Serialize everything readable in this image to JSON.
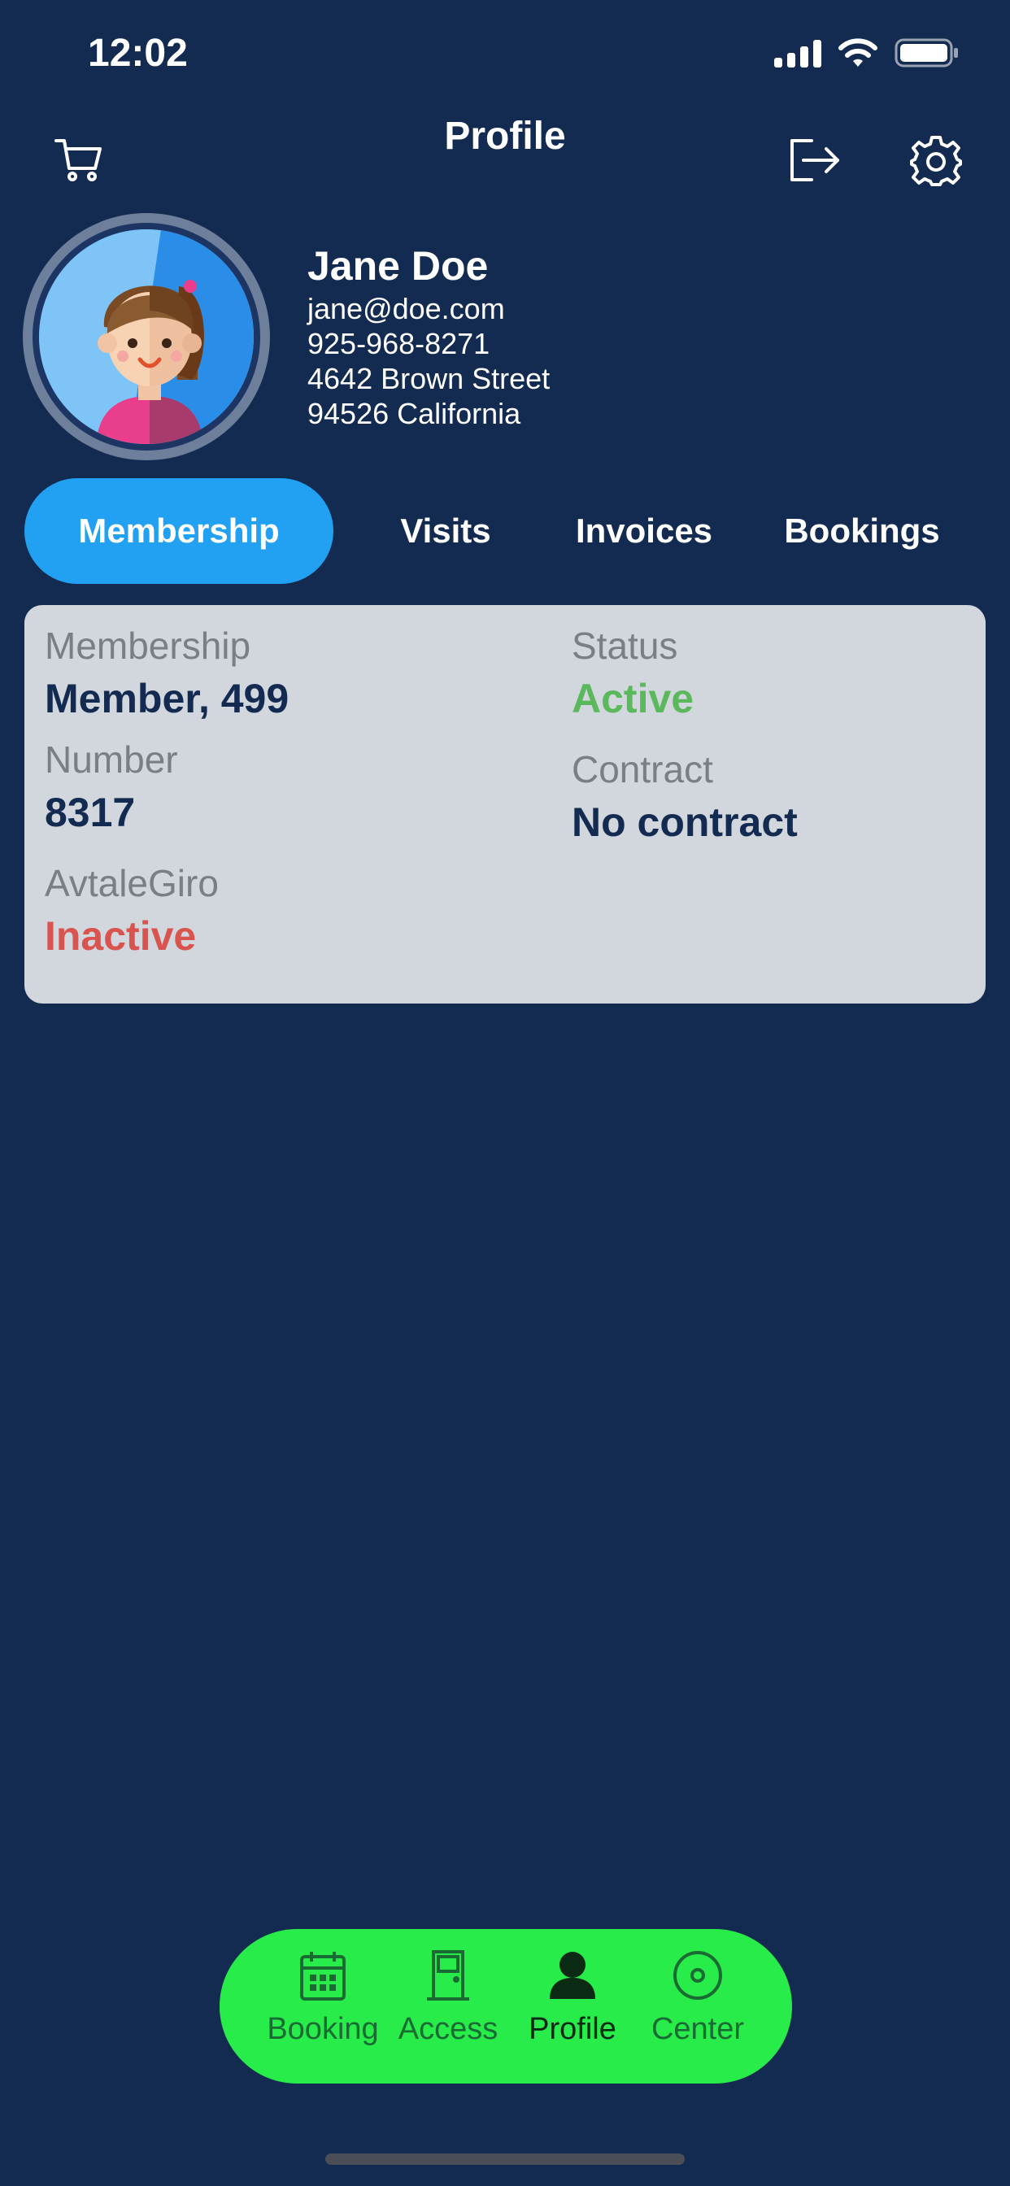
{
  "status_bar": {
    "time": "12:02",
    "icons": [
      "signal-icon",
      "wifi-icon",
      "battery-icon"
    ]
  },
  "header": {
    "title": "Profile",
    "icons": [
      "cart-icon",
      "logout-icon",
      "settings-icon"
    ]
  },
  "profile": {
    "avatar": "avatar-girl-illustration",
    "name": "Jane Doe",
    "email": "jane@doe.com",
    "phone": "925-968-8271",
    "street": "4642 Brown Street",
    "city": "94526 California"
  },
  "tabs": [
    {
      "label": "Membership",
      "active": true
    },
    {
      "label": "Visits",
      "active": false
    },
    {
      "label": "Invoices",
      "active": false
    },
    {
      "label": "Bookings",
      "active": false
    }
  ],
  "membership_card": {
    "membership_label": "Membership",
    "membership_value": "Member, 499",
    "number_label": "Number",
    "number_value": "8317",
    "avtalegiro_label": "AvtaleGiro",
    "avtalegiro_value": "Inactive",
    "status_label": "Status",
    "status_value": "Active",
    "contract_label": "Contract",
    "contract_value": "No contract"
  },
  "bottom_nav": [
    {
      "label": "Booking",
      "icon": "calendar-icon"
    },
    {
      "label": "Access",
      "icon": "door-icon"
    },
    {
      "label": "Profile",
      "icon": "person-icon",
      "selected": true
    },
    {
      "label": "Center",
      "icon": "target-icon"
    }
  ],
  "colors": {
    "background": "#132b50",
    "tab_active": "#22a0f2",
    "card": "#d2d6dd",
    "status_active": "#5cb85c",
    "status_inactive": "#d9534f",
    "nav_bar": "#27ec4a"
  }
}
